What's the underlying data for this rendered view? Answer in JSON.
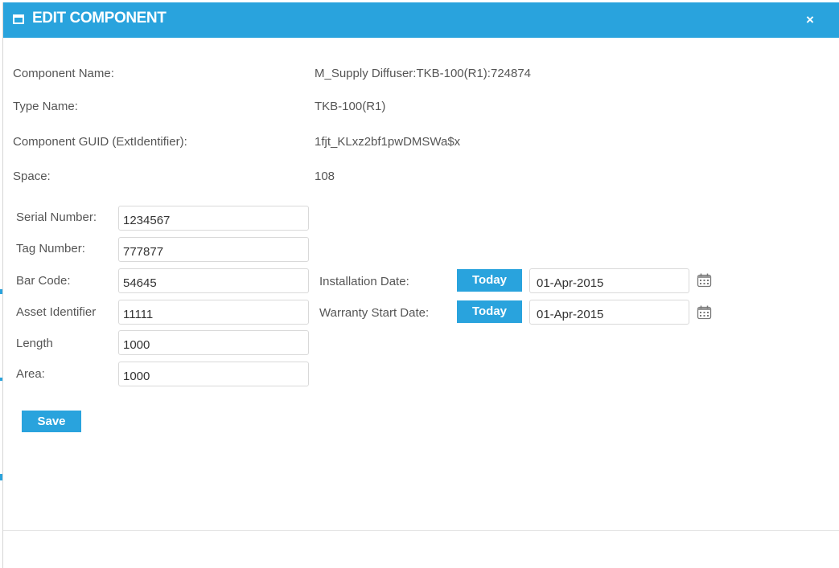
{
  "dialog": {
    "title": "EDIT COMPONENT",
    "close_label": "×",
    "icon": "window-icon",
    "accent_color": "#29a3dd"
  },
  "info": {
    "component_name_label": "Component Name:",
    "component_name_value": "M_Supply Diffuser:TKB-100(R1):724874",
    "type_name_label": "Type Name:",
    "type_name_value": "TKB-100(R1)",
    "guid_label": "Component GUID (ExtIdentifier):",
    "guid_value": "1fjt_KLxz2bf1pwDMSWa$x",
    "space_label": "Space:",
    "space_value": "108"
  },
  "form": {
    "serial_label": "Serial Number:",
    "serial_value": "1234567",
    "tag_label": "Tag Number:",
    "tag_value": "777877",
    "barcode_label": "Bar Code:",
    "barcode_value": "54645",
    "asset_label": "Asset Identifier",
    "asset_value": "11111",
    "length_label": "Length",
    "length_value": "1000",
    "area_label": "Area:",
    "area_value": "1000"
  },
  "dates": {
    "installation_label": "Installation Date:",
    "installation_today": "Today",
    "installation_value": "01-Apr-2015",
    "warranty_label": "Warranty Start Date:",
    "warranty_today": "Today",
    "warranty_value": "01-Apr-2015",
    "calendar_icon": "calendar-icon"
  },
  "actions": {
    "save_label": "Save"
  }
}
